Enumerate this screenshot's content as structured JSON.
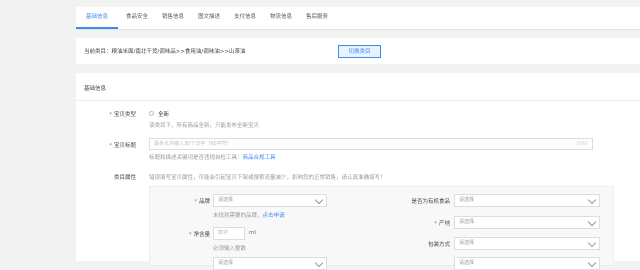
{
  "tabs": [
    {
      "label": "基础信息",
      "active": true
    },
    {
      "label": "食品安全",
      "active": false
    },
    {
      "label": "销售信息",
      "active": false
    },
    {
      "label": "图文描述",
      "active": false
    },
    {
      "label": "支付信息",
      "active": false
    },
    {
      "label": "物流信息",
      "active": false
    },
    {
      "label": "售后服务",
      "active": false
    }
  ],
  "category": {
    "current": "当前类目：粮油米面/南北干货/调味品>>食用油/调味油>>山茶油",
    "switch_button": "切换类目"
  },
  "section": {
    "title": "基础信息"
  },
  "fields": {
    "item_type": {
      "label": "宝贝类型",
      "option": "全新",
      "hint": "该类目下，所有商品全新，只能发布全新宝贝"
    },
    "title": {
      "label": "宝贝标题",
      "placeholder": "最多允许输入30个汉字（60字符）",
      "counter": "0/60",
      "hint": "标题和描述关键词是否违规自检工具：",
      "hint_link": "商品合规工具"
    },
    "attributes": {
      "label": "类目属性",
      "hint": "错误填写宝贝属性，可能会引起宝贝下架或搜索流量减少，影响您的正常销售，请认真准确填写！",
      "brand": {
        "label": "品牌",
        "placeholder": "请选择",
        "hint": "未找到需要的品牌，",
        "hint_link": "点击申请"
      },
      "organic": {
        "label": "是否为有机食品",
        "placeholder": "请选择"
      },
      "origin": {
        "label": "产地",
        "placeholder": "请选择"
      },
      "net_content": {
        "label": "净含量",
        "placeholder": "数字",
        "unit": "ml",
        "hint": "必须输入整数"
      },
      "packaging": {
        "label": "包装方式",
        "placeholder": "请选择"
      },
      "bottom_left": {
        "placeholder": "请选择"
      },
      "bottom_right": {
        "placeholder": "请选择"
      }
    }
  },
  "colors": {
    "accent": "#3b8cf2",
    "required": "#e53333"
  }
}
